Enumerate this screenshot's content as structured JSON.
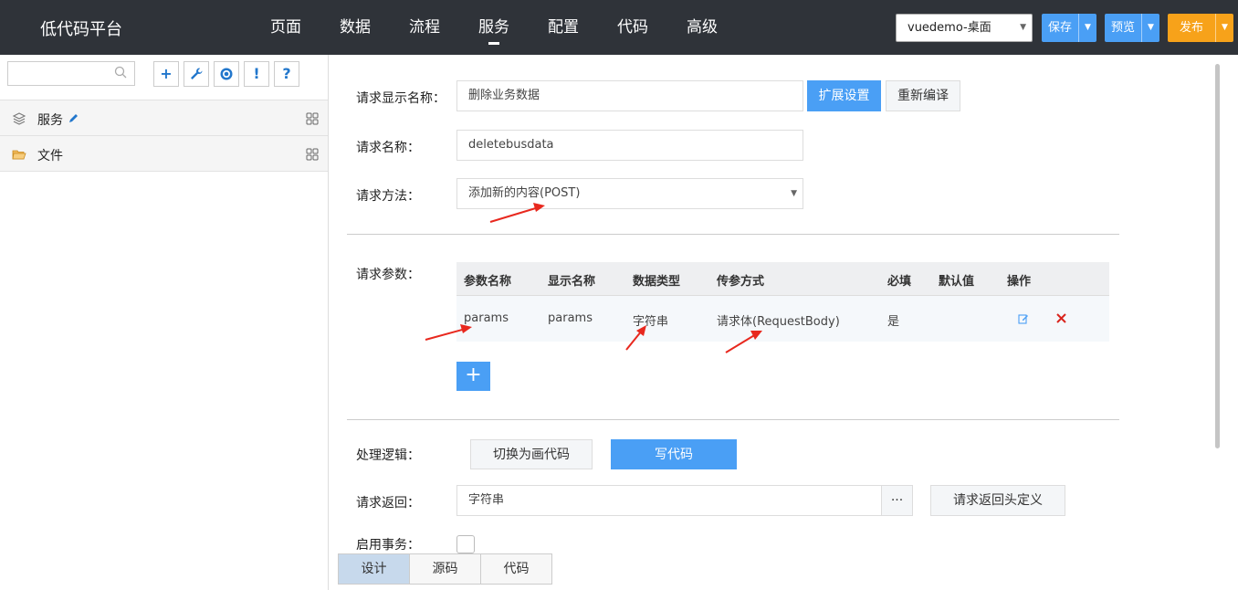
{
  "header": {
    "brand": "低代码平台",
    "nav": [
      "页面",
      "数据",
      "流程",
      "服务",
      "配置",
      "代码",
      "高级"
    ],
    "active_nav": "服务",
    "project": "vuedemo-桌面",
    "save_label": "保存",
    "preview_label": "预览",
    "publish_label": "发布"
  },
  "sidebar": {
    "search_placeholder": "",
    "tools": [
      "+",
      "wrench-icon",
      "target-icon",
      "!",
      "?"
    ],
    "items": [
      {
        "label": "服务",
        "icon": "layers-icon"
      },
      {
        "label": "文件",
        "icon": "folder-icon"
      }
    ]
  },
  "form": {
    "display_name_label": "请求显示名称：",
    "display_name_value": "删除业务数据",
    "ext_settings_label": "扩展设置",
    "recompile_label": "重新编译",
    "name_label": "请求名称：",
    "name_value": "deletebusdata",
    "method_label": "请求方法：",
    "method_value": "添加新的内容(POST)",
    "params_label": "请求参数：",
    "logic_label": "处理逻辑：",
    "switch_visual_label": "切换为画代码",
    "write_code_label": "写代码",
    "return_label": "请求返回：",
    "return_value": "字符串",
    "return_more": "···",
    "return_header_label": "请求返回头定义",
    "transaction_label": "启用事务："
  },
  "params_table": {
    "headers": [
      "参数名称",
      "显示名称",
      "数据类型",
      "传参方式",
      "必填",
      "默认值",
      "操作"
    ],
    "rows": [
      {
        "name": "params",
        "display": "params",
        "type": "字符串",
        "mode": "请求体(RequestBody)",
        "required": "是",
        "default": ""
      }
    ],
    "add_label": "+"
  },
  "bottom_tabs": [
    "设计",
    "源码",
    "代码"
  ],
  "colors": {
    "topbar": "#2f3339",
    "primary": "#4a9ff5",
    "publish": "#f7a21a",
    "annotation": "#e8281e"
  }
}
